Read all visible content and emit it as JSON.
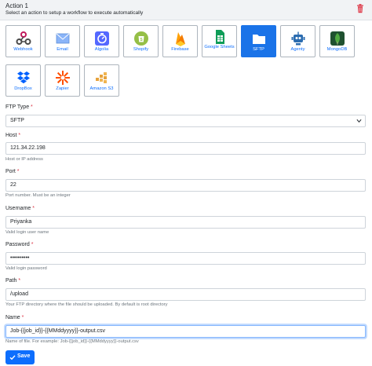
{
  "header": {
    "title": "Action 1",
    "subtitle": "Select an action to setup a workflow to execute automatically"
  },
  "actions": [
    {
      "label": "Webhook",
      "icon": "webhook-icon",
      "selected": false
    },
    {
      "label": "Email",
      "icon": "email-icon",
      "selected": false
    },
    {
      "label": "Algolia",
      "icon": "algolia-icon",
      "selected": false
    },
    {
      "label": "Shopify",
      "icon": "shopify-icon",
      "selected": false
    },
    {
      "label": "Firebase",
      "icon": "firebase-icon",
      "selected": false
    },
    {
      "label": "Google Sheets",
      "icon": "google-sheets-icon",
      "selected": false
    },
    {
      "label": "SFTP",
      "icon": "folder-icon",
      "selected": true
    },
    {
      "label": "Agenty",
      "icon": "robot-icon",
      "selected": false
    },
    {
      "label": "MongoDB",
      "icon": "mongodb-icon",
      "selected": false
    },
    {
      "label": "DropBox",
      "icon": "dropbox-icon",
      "selected": false
    },
    {
      "label": "Zapier",
      "icon": "zapier-icon",
      "selected": false
    },
    {
      "label": "Amazon S3",
      "icon": "amazon-s3-icon",
      "selected": false
    }
  ],
  "form": {
    "ftp_type": {
      "label": "FTP Type",
      "value": "SFTP"
    },
    "host": {
      "label": "Host",
      "value": "121.34.22.198",
      "help": "Host or IP address"
    },
    "port": {
      "label": "Port",
      "value": "22",
      "help": "Port number. Must be an integer"
    },
    "username": {
      "label": "Username",
      "value": "Priyanka",
      "help": "Valid login user name"
    },
    "password": {
      "label": "Password",
      "value": "••••••••••",
      "help": "Valid login password"
    },
    "path": {
      "label": "Path",
      "value": "/upload",
      "help": "Your FTP directory where the file should be uploaded. By default is root directory"
    },
    "name": {
      "label": "Name",
      "value": "Job-{{job_id}}-{{MMddyyyy}}-output.csv",
      "help": "Name of file. For example: Job-{{job_id}}-{{MMddyyyy}}-output.csv"
    },
    "required_marker": "*"
  },
  "save": {
    "label": "Save"
  },
  "colors": {
    "accent": "#0d6efd",
    "selected_tile": "#1a73e8",
    "required": "#dc3545",
    "delete": "#dc3545"
  }
}
